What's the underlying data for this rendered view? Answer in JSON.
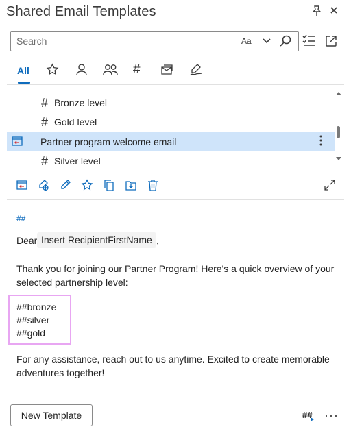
{
  "window": {
    "title": "Shared Email Templates"
  },
  "search": {
    "placeholder": "Search",
    "match_case_label": "Aa"
  },
  "tabs": [
    {
      "label": "All",
      "icon": "all",
      "active": true
    },
    {
      "label": "",
      "icon": "star-icon"
    },
    {
      "label": "",
      "icon": "person-icon"
    },
    {
      "label": "",
      "icon": "people-icon"
    },
    {
      "label": "",
      "icon": "hash-icon"
    },
    {
      "label": "",
      "icon": "email-icon"
    },
    {
      "label": "",
      "icon": "signature-pen-icon"
    }
  ],
  "list": {
    "items": [
      {
        "label": "Bronze level",
        "type": "macro",
        "prefix": "#"
      },
      {
        "label": "Gold level",
        "type": "macro",
        "prefix": "#"
      },
      {
        "label": "Partner program welcome email",
        "type": "template",
        "selected": true
      },
      {
        "label": "Silver level",
        "type": "macro",
        "prefix": "#"
      }
    ]
  },
  "preview": {
    "hash_marker": "##",
    "greeting": "Dear",
    "field_chip": "Insert RecipientFirstName",
    "greeting_suffix": ",",
    "paragraph1": "Thank you for joining our Partner Program! Here's a quick overview of your selected partnership level:",
    "code_lines": [
      "##bronze",
      "##silver",
      "##gold"
    ],
    "paragraph2": "For any assistance, reach out to us anytime. Excited to create memorable adventures together!"
  },
  "footer": {
    "new_template_label": "New Template",
    "insert_placeholder_label": "##",
    "more_label": "···"
  },
  "colors": {
    "accent": "#0f6cbd",
    "selected_row": "#cfe4fa",
    "highlight_box": "#e8a6f2"
  }
}
